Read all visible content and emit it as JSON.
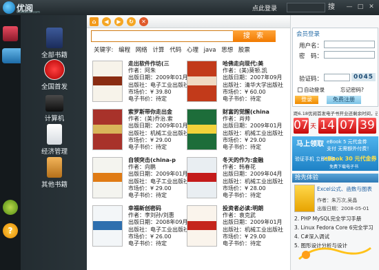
{
  "app": {
    "logo_text": "优阅",
    "logo_sub": "Uokbook.com",
    "login_link": "点此登录",
    "search_button": "搜",
    "minimize": "—",
    "maximize": "□",
    "close": "✕"
  },
  "categories": [
    {
      "label": "全部书籍",
      "icon": "book-icon",
      "active": false
    },
    {
      "label": "全国首发",
      "icon": "first-release-icon",
      "active": true
    },
    {
      "label": "计算机",
      "icon": "computer-icon",
      "active": false
    },
    {
      "label": "经济管理",
      "icon": "economics-icon",
      "active": false
    },
    {
      "label": "其他书籍",
      "icon": "other-books-icon",
      "active": false
    }
  ],
  "search": {
    "button": "搜 索",
    "keywords_label": "关键字:",
    "keywords": [
      "编程",
      "网络",
      "计算",
      "代码",
      "心理",
      "java",
      "思想",
      "股票"
    ]
  },
  "books": [
    {
      "title": "走出软件作坊(三",
      "author": "作者：阿朱",
      "date": "出版日期：2009年01月",
      "publisher": "出版社：电子工业出版社",
      "price": "市场价：¥ 39.80",
      "eprice": "电子书价：待定",
      "cover": "#f7f3ea",
      "accent": "#8a2c12"
    },
    {
      "title": "哈佛走向现代:美",
      "author": "作者：(美)莫顿.凯",
      "date": "出版日期：2007年09月",
      "publisher": "出版社：清华大学出版社",
      "price": "市场价：¥ 60.00",
      "eprice": "电子书价：待定",
      "cover": "#c23a1a",
      "accent": "#f0d9c2"
    },
    {
      "title": "索罗斯带你走出金",
      "author": "作者：(美)乔治.索",
      "date": "出版日期：2009年01月",
      "publisher": "出版社：机械工业出版社",
      "price": "市场价：¥ 29.00",
      "eprice": "电子书价：待定",
      "cover": "#a8322a",
      "accent": "#d9b55a"
    },
    {
      "title": "财富的觉醒(china",
      "author": "作者：肖帅",
      "date": "出版日期：2009年01月",
      "publisher": "出版社：机械工业出版社",
      "price": "市场价：¥ 29.00",
      "eprice": "电子书价：待定",
      "cover": "#1d6d3a",
      "accent": "#f3d23a"
    },
    {
      "title": "自领突击(china-p",
      "author": "作者：向鹏",
      "date": "出版日期：2009年01月",
      "publisher": "出版社：电子工业出版社",
      "price": "市场价：¥ 29.00",
      "eprice": "电子书价：待定",
      "cover": "#f4f4ef",
      "accent": "#e07b14"
    },
    {
      "title": "冬天的作为:金融",
      "author": "作者：韩春花",
      "date": "出版日期：2009年04月",
      "publisher": "出版社：机械工业出版社",
      "price": "市场价：¥ 28.00",
      "eprice": "电子书价：待定",
      "cover": "#e9eef2",
      "accent": "#c41b1b"
    },
    {
      "title": "幸福新创密码",
      "author": "作者：李刘孙/刘惠",
      "date": "出版日期：2008年09月",
      "publisher": "出版社：电子工业出版社",
      "price": "市场价：¥ 26.00",
      "eprice": "电子书价：待定",
      "cover": "#f3f6f8",
      "accent": "#2e6fae"
    },
    {
      "title": "投资者必读:明朗",
      "author": "作者：袁克武",
      "date": "出版日期：2009年01月",
      "publisher": "出版社：机械工业出版社",
      "price": "市场价：¥ 29.00",
      "eprice": "电子书价：待定",
      "cover": "#faf4ec",
      "accent": "#c5261d"
    }
  ],
  "login": {
    "head": "会员登录",
    "user_label": "用户名：",
    "pass_label": "密　码：",
    "code_label": "验证码：",
    "captcha": "0045",
    "auto_login": "自动登录",
    "forgot": "忘记密码?",
    "login_btn": "登录",
    "register_btn": "免费注册"
  },
  "notice": "距6.18优阅首发电子书开业还剩余时间，还有",
  "timer": {
    "days": "07",
    "days_label": "天",
    "hours": "14",
    "mins": "07",
    "secs": "39"
  },
  "promo": {
    "line1": "马上领取",
    "line2": "eBook 5 元代金券",
    "line3": "支付 无需额外付费！",
    "line4": "验证手机 立即领取",
    "line5": "eBook 30 元代金券",
    "brand": "免费下载电子书"
  },
  "hot": {
    "head": "抢先体验",
    "feature_title": "Excel公式、函数与图表",
    "feature_author": "作者：朱万次,吴晶",
    "feature_date": "出版日期：2008-05-01",
    "items": [
      "2. PHP MySQL完全学习手册",
      "3. Linux Fedora Core 6完全学习",
      "4. C#深入调试",
      "5. 图形设计分析与设计"
    ]
  }
}
